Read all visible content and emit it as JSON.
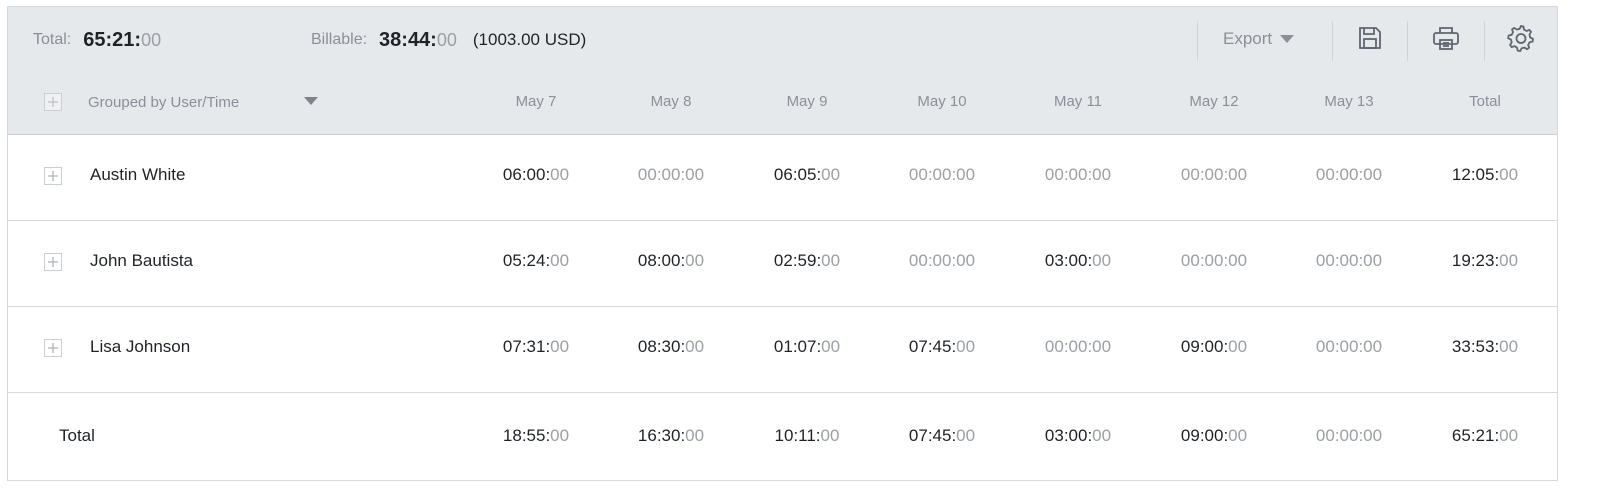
{
  "summary": {
    "total_label": "Total:",
    "total_hm": "65:21:",
    "total_s": "00",
    "billable_label": "Billable:",
    "billable_hm": "38:44:",
    "billable_s": "00",
    "billable_amount": "(1003.00 USD)"
  },
  "toolbar": {
    "export_label": "Export",
    "icons": [
      "save-icon",
      "print-icon",
      "gear-icon"
    ]
  },
  "grouping": {
    "label": "Grouped by User/Time"
  },
  "columns": [
    "May 7",
    "May 8",
    "May 9",
    "May 10",
    "May 11",
    "May 12",
    "May 13",
    "Total"
  ],
  "rows": [
    {
      "name": "Austin White",
      "cells": [
        "06:00:|00",
        "00:00:00",
        "06:05:|00",
        "00:00:00",
        "00:00:00",
        "00:00:00",
        "00:00:00",
        "12:05:|00"
      ]
    },
    {
      "name": "John Bautista",
      "cells": [
        "05:24:|00",
        "08:00:|00",
        "02:59:|00",
        "00:00:00",
        "03:00:|00",
        "00:00:00",
        "00:00:00",
        "19:23:|00"
      ]
    },
    {
      "name": "Lisa Johnson",
      "cells": [
        "07:31:|00",
        "08:30:|00",
        "01:07:|00",
        "07:45:|00",
        "00:00:00",
        "09:00:|00",
        "00:00:00",
        "33:53:|00"
      ]
    }
  ],
  "totals": {
    "label": "Total",
    "cells": [
      "18:55:|00",
      "16:30:|00",
      "10:11:|00",
      "07:45:|00",
      "03:00:|00",
      "09:00:|00",
      "00:00:00",
      "65:21:|00"
    ]
  },
  "colors": {
    "header_bg": "#e6e9ec",
    "muted": "#9aa0a6",
    "text": "#1f2328",
    "border": "#d6dadf"
  }
}
